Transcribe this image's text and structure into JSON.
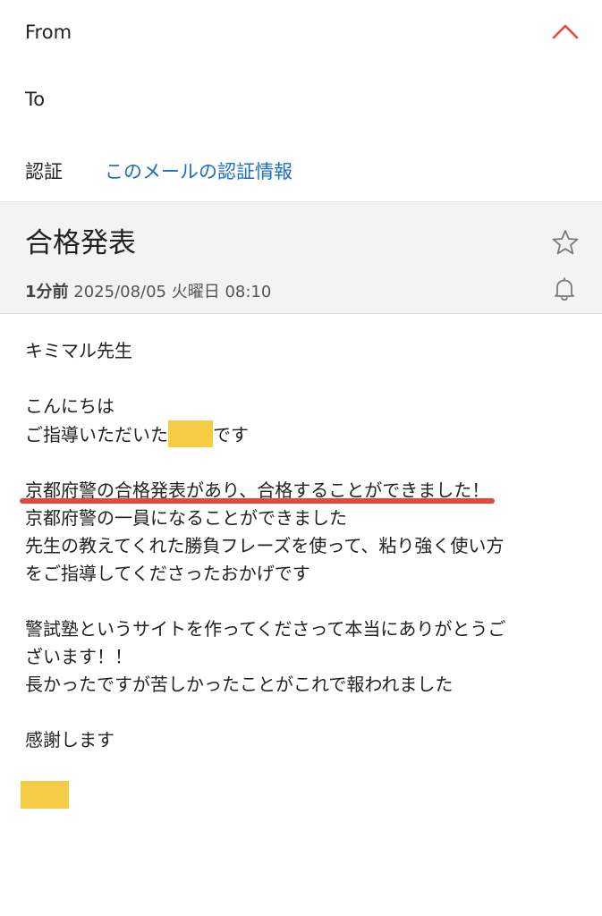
{
  "header": {
    "from_label": "From",
    "to_label": "To",
    "to_value": "",
    "auth_label": "認証",
    "auth_link": "このメールの認証情報"
  },
  "message": {
    "subject": "合格発表",
    "time_ago": "1分前",
    "datetime": "2025/08/05 火曜日 08:10"
  },
  "body": {
    "greeting": "キミマル先生",
    "hello": "こんにちは",
    "intro_prefix": "ご指導いただいた",
    "intro_suffix": "です",
    "highlight": "京都府警の合格発表があり、合格することができました！",
    "line2": "京都府警の一員になることができました",
    "line3": "先生の教えてくれた勝負フレーズを使って、粘り強く使い方",
    "line4": "をご指導してくださったおかげです",
    "line5": "警試塾というサイトを作ってくださって本当にありがとうご",
    "line6": "ざいます！！",
    "line7": "長かったですが苦しかったことがこれで報われました",
    "closing": "感謝します"
  },
  "colors": {
    "accent_link": "#1a6fc4",
    "chevron": "#e4493d",
    "underline": "#e4493d",
    "redaction": "#f5cc45"
  },
  "icons": {
    "collapse": "chevron-up-icon",
    "favorite": "star-icon",
    "notify": "bell-icon"
  }
}
